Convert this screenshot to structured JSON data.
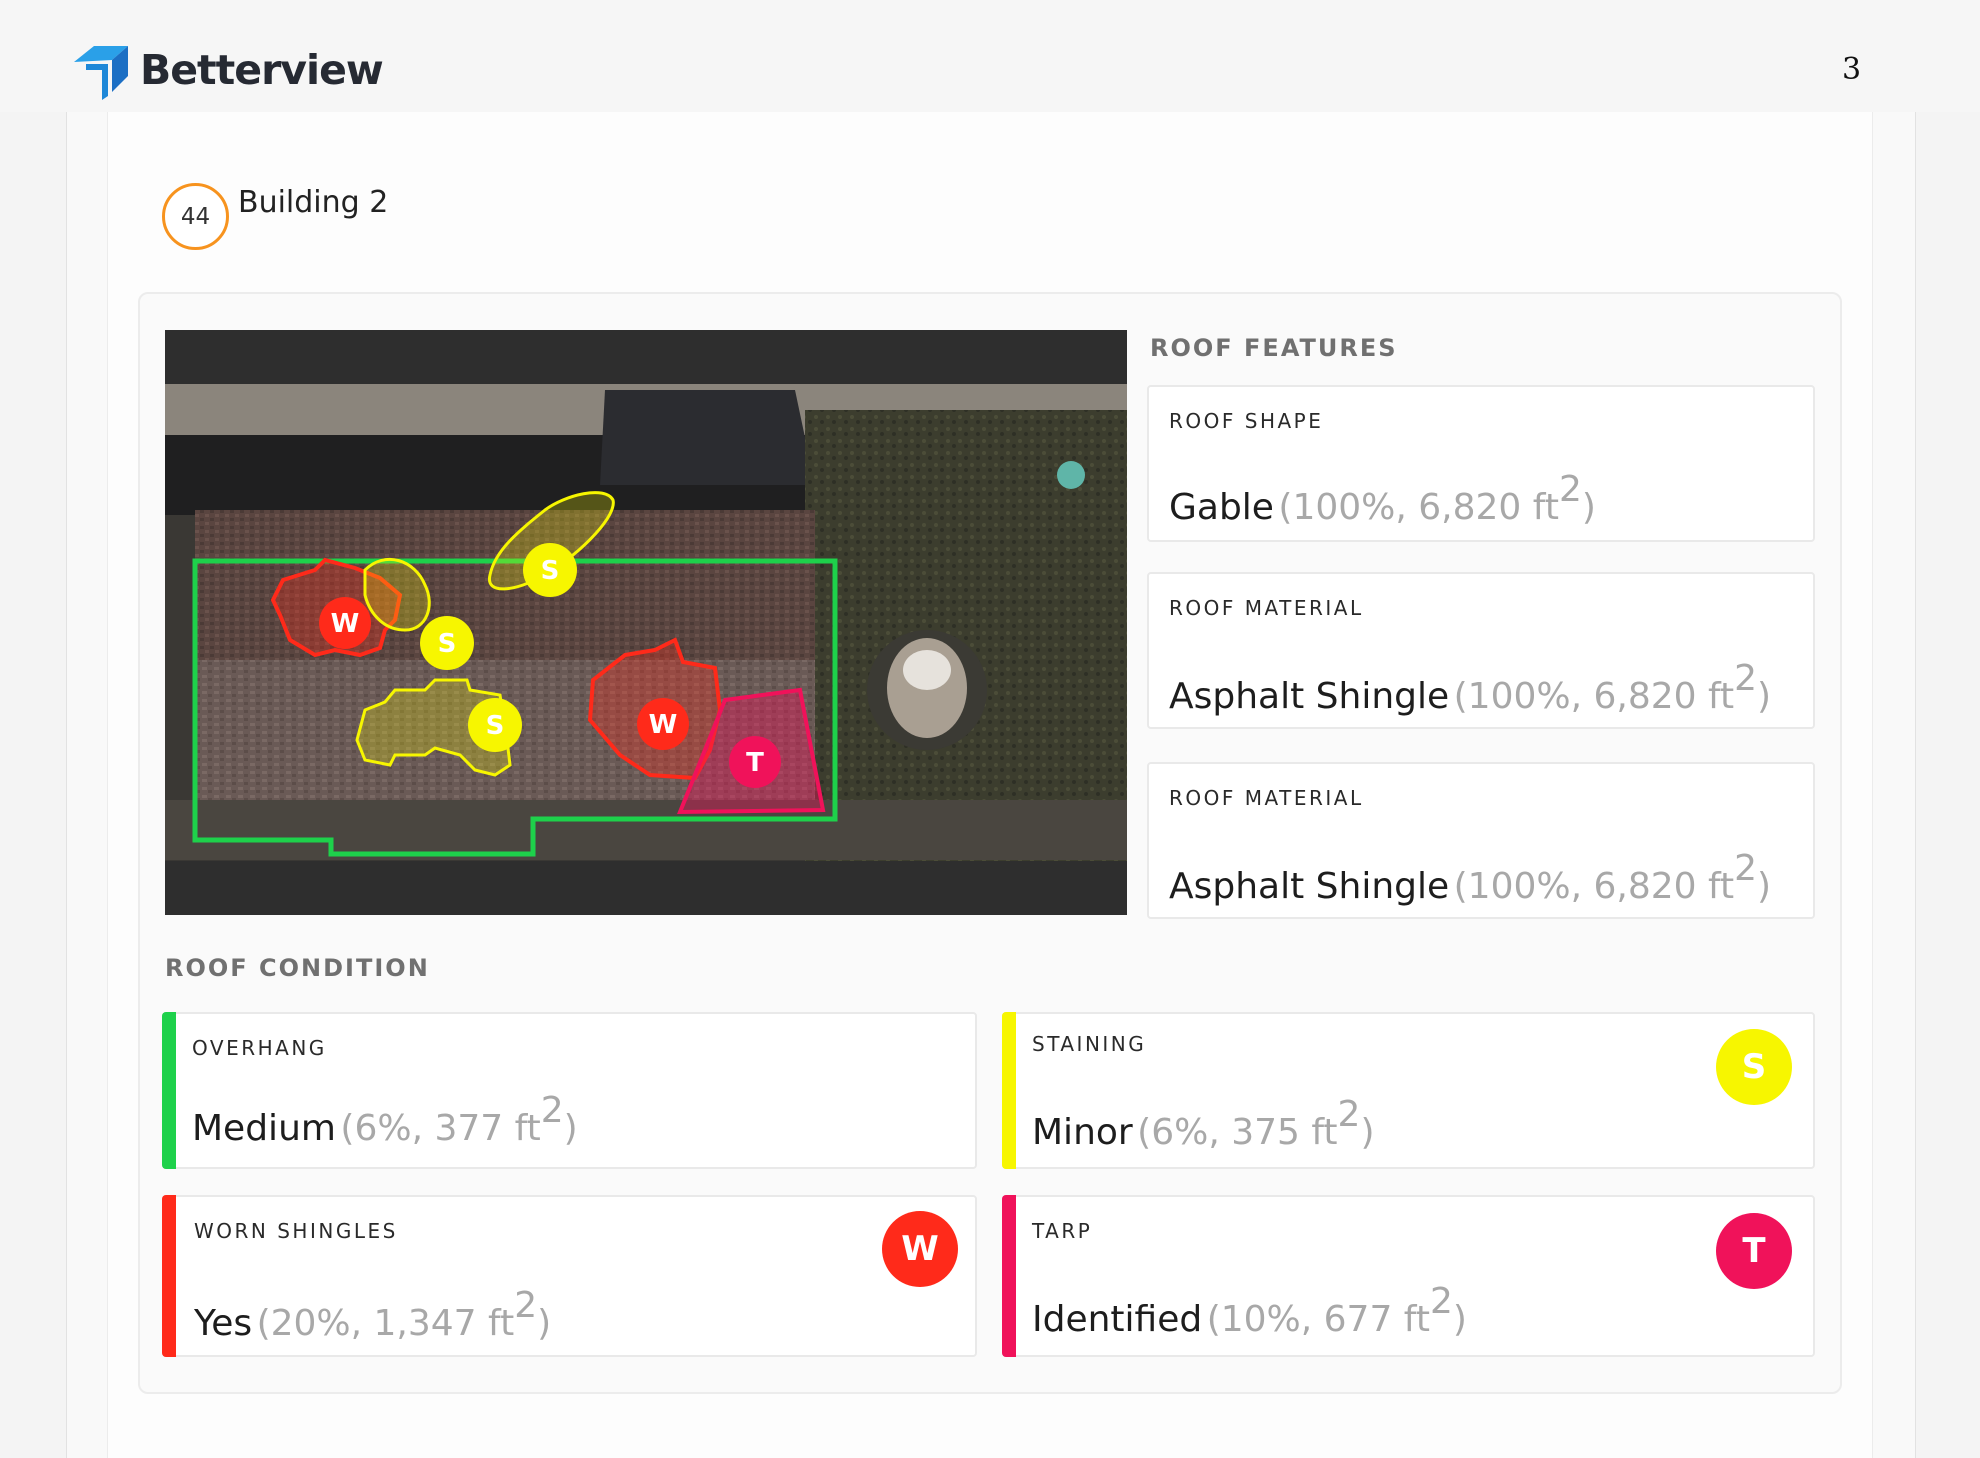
{
  "header": {
    "brand": "Betterview",
    "page_number": "3"
  },
  "building": {
    "score": "44",
    "title": "Building 2"
  },
  "roof_features": {
    "heading": "ROOF FEATURES",
    "cards": [
      {
        "label": "ROOF SHAPE",
        "value": "Gable",
        "detail": "(100%, 6,820 ft",
        "unit_sup": "2",
        "close": ")"
      },
      {
        "label": "ROOF MATERIAL",
        "value": "Asphalt Shingle",
        "detail": "(100%, 6,820 ft",
        "unit_sup": "2",
        "close": ")"
      },
      {
        "label": "ROOF MATERIAL",
        "value": "Asphalt Shingle",
        "detail": "(100%, 6,820 ft",
        "unit_sup": "2",
        "close": ")"
      }
    ]
  },
  "roof_condition": {
    "heading": "ROOF CONDITION",
    "cards": [
      {
        "label": "OVERHANG",
        "value": "Medium",
        "detail": "(6%, 377 ft",
        "unit_sup": "2",
        "close": ")",
        "color": "#1ed14b",
        "marker": ""
      },
      {
        "label": "STAINING",
        "value": "Minor",
        "detail": "(6%, 375 ft",
        "unit_sup": "2",
        "close": ")",
        "color": "#f7f600",
        "marker": "S"
      },
      {
        "label": "WORN SHINGLES",
        "value": "Yes",
        "detail": "(20%, 1,347 ft",
        "unit_sup": "2",
        "close": ")",
        "color": "#ff2a1a",
        "marker": "W"
      },
      {
        "label": "TARP",
        "value": "Identified",
        "detail": "(10%, 677 ft",
        "unit_sup": "2",
        "close": ")",
        "color": "#f0125a",
        "marker": "T"
      }
    ]
  },
  "imagery": {
    "markers": [
      "W",
      "S",
      "S",
      "S",
      "W",
      "T"
    ],
    "colors": {
      "overhang": "#1ed14b",
      "staining": "#f7f600",
      "worn": "#ff2a1a",
      "tarp": "#f0125a"
    }
  }
}
